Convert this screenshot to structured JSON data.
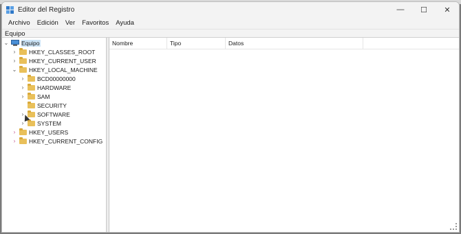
{
  "window": {
    "title": "Editor del Registro"
  },
  "menu": [
    "Archivo",
    "Edición",
    "Ver",
    "Favoritos",
    "Ayuda"
  ],
  "address": "Equipo",
  "tree": [
    {
      "label": "Equipo",
      "chevron": "down",
      "icon": "computer-icon",
      "selected": true
    },
    {
      "label": "HKEY_CLASSES_ROOT",
      "chevron": "right",
      "icon": "folder-icon"
    },
    {
      "label": "HKEY_CURRENT_USER",
      "chevron": "right",
      "icon": "folder-icon"
    },
    {
      "label": "HKEY_LOCAL_MACHINE",
      "chevron": "down",
      "icon": "folder-icon"
    },
    {
      "label": "BCD00000000",
      "chevron": "right",
      "icon": "folder-icon"
    },
    {
      "label": "HARDWARE",
      "chevron": "right",
      "icon": "folder-icon"
    },
    {
      "label": "SAM",
      "chevron": "right",
      "icon": "folder-icon"
    },
    {
      "label": "SECURITY",
      "chevron": "",
      "icon": "folder-icon"
    },
    {
      "label": "SOFTWARE",
      "chevron": "right",
      "icon": "folder-icon"
    },
    {
      "label": "SYSTEM",
      "chevron": "right",
      "icon": "folder-icon"
    },
    {
      "label": "HKEY_USERS",
      "chevron": "right",
      "icon": "folder-icon"
    },
    {
      "label": "HKEY_CURRENT_CONFIG",
      "chevron": "right",
      "icon": "folder-icon"
    }
  ],
  "columns": [
    "Nombre",
    "Tipo",
    "Datos"
  ],
  "colors": {
    "selection": "#cce4f7",
    "folder": "#e9c05a",
    "accent": "#2f79c9"
  }
}
